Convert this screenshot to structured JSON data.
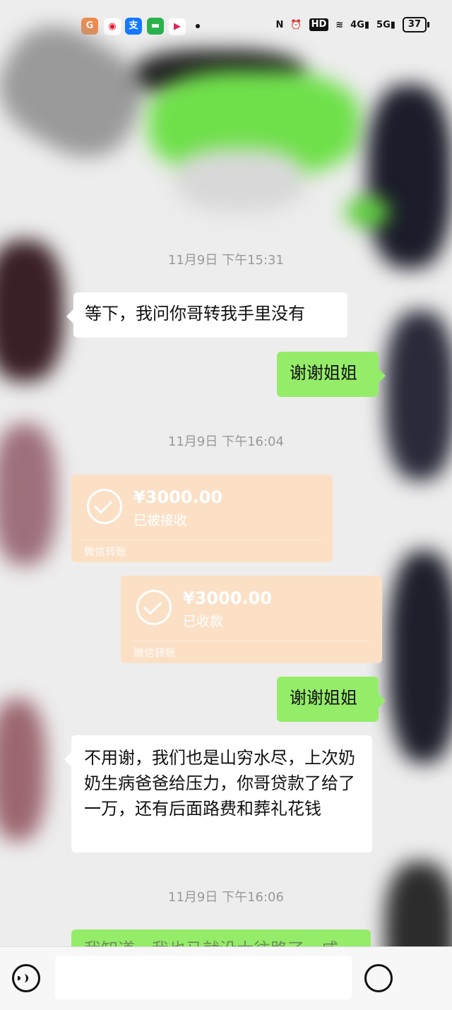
{
  "status_bar": {
    "network_4g": "4G",
    "network_5g": "5G",
    "hd": "HD",
    "battery": "37"
  },
  "messages": {
    "time1": "11月9日 下午15:31",
    "m1": "等下，我问你哥转我手里没有",
    "m2": "谢谢姐姐",
    "time2": "11月9日 下午16:04",
    "t1_amount": "¥3000.00",
    "t1_state": "已被接收",
    "t1_src": "微信转账",
    "t2_amount": "¥3000.00",
    "t2_state": "已收款",
    "t2_src": "微信转账",
    "m3": "谢谢姐姐",
    "m4": "不用谢，我们也是山穷水尽，上次奶奶生病爸爸给压力，你哥贷款了给了一万，还有后面路费和葬礼花钱",
    "time3": "11月9日 下午16:06",
    "m5_partial": "我知道，我也马就没大往路了一咸"
  },
  "input_bar": {
    "placeholder": ""
  }
}
